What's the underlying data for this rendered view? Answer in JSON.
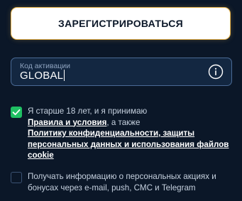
{
  "register_button": {
    "label": "ЗАРЕГИСТРИРОВАТЬСЯ"
  },
  "activation_code": {
    "label": "Код активации",
    "value": "GLOBAL"
  },
  "age_consent": {
    "checked": true,
    "text_before": "Я старше 18 лет, и я принимаю",
    "terms_link": "Правила и условия",
    "text_middle": ", а также",
    "privacy_link": "Политику конфиденциальности, защиты персональных данных и использования файлов cookie"
  },
  "promo_consent": {
    "checked": false,
    "text": "Получать информацию о персональных акциях и бонусах через e-mail, push, СМС и Telegram"
  },
  "colors": {
    "background": "#0b1728",
    "accent_green": "#1fbf63",
    "button_border": "#e9b44c"
  }
}
